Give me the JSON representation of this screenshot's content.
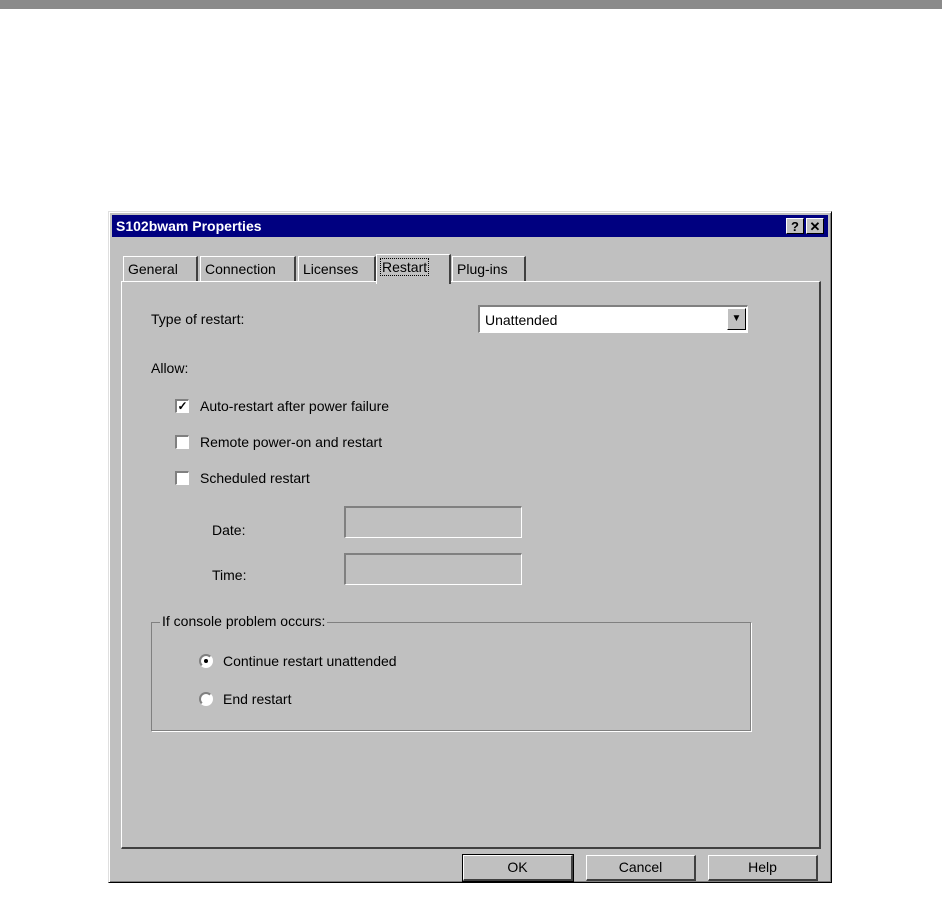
{
  "window": {
    "title": "S102bwam Properties",
    "help_glyph": "?",
    "close_glyph": "✕"
  },
  "tabs": [
    {
      "label": "General"
    },
    {
      "label": "Connection"
    },
    {
      "label": "Licenses"
    },
    {
      "label": "Restart",
      "active": true
    },
    {
      "label": "Plug-ins"
    }
  ],
  "restart": {
    "type_label": "Type of restart:",
    "type_value": "Unattended",
    "allow_label": "Allow:",
    "options": [
      {
        "label": "Auto-restart after power failure",
        "checked": true
      },
      {
        "label": "Remote power-on and restart",
        "checked": false
      },
      {
        "label": "Scheduled restart",
        "checked": false
      }
    ],
    "date_label": "Date:",
    "date_value": "",
    "time_label": "Time:",
    "time_value": "",
    "console_group": {
      "legend": "If console problem occurs:",
      "choices": [
        {
          "label": "Continue restart unattended",
          "selected": true
        },
        {
          "label": "End restart",
          "selected": false
        }
      ]
    }
  },
  "buttons": {
    "ok": "OK",
    "cancel": "Cancel",
    "help": "Help"
  }
}
